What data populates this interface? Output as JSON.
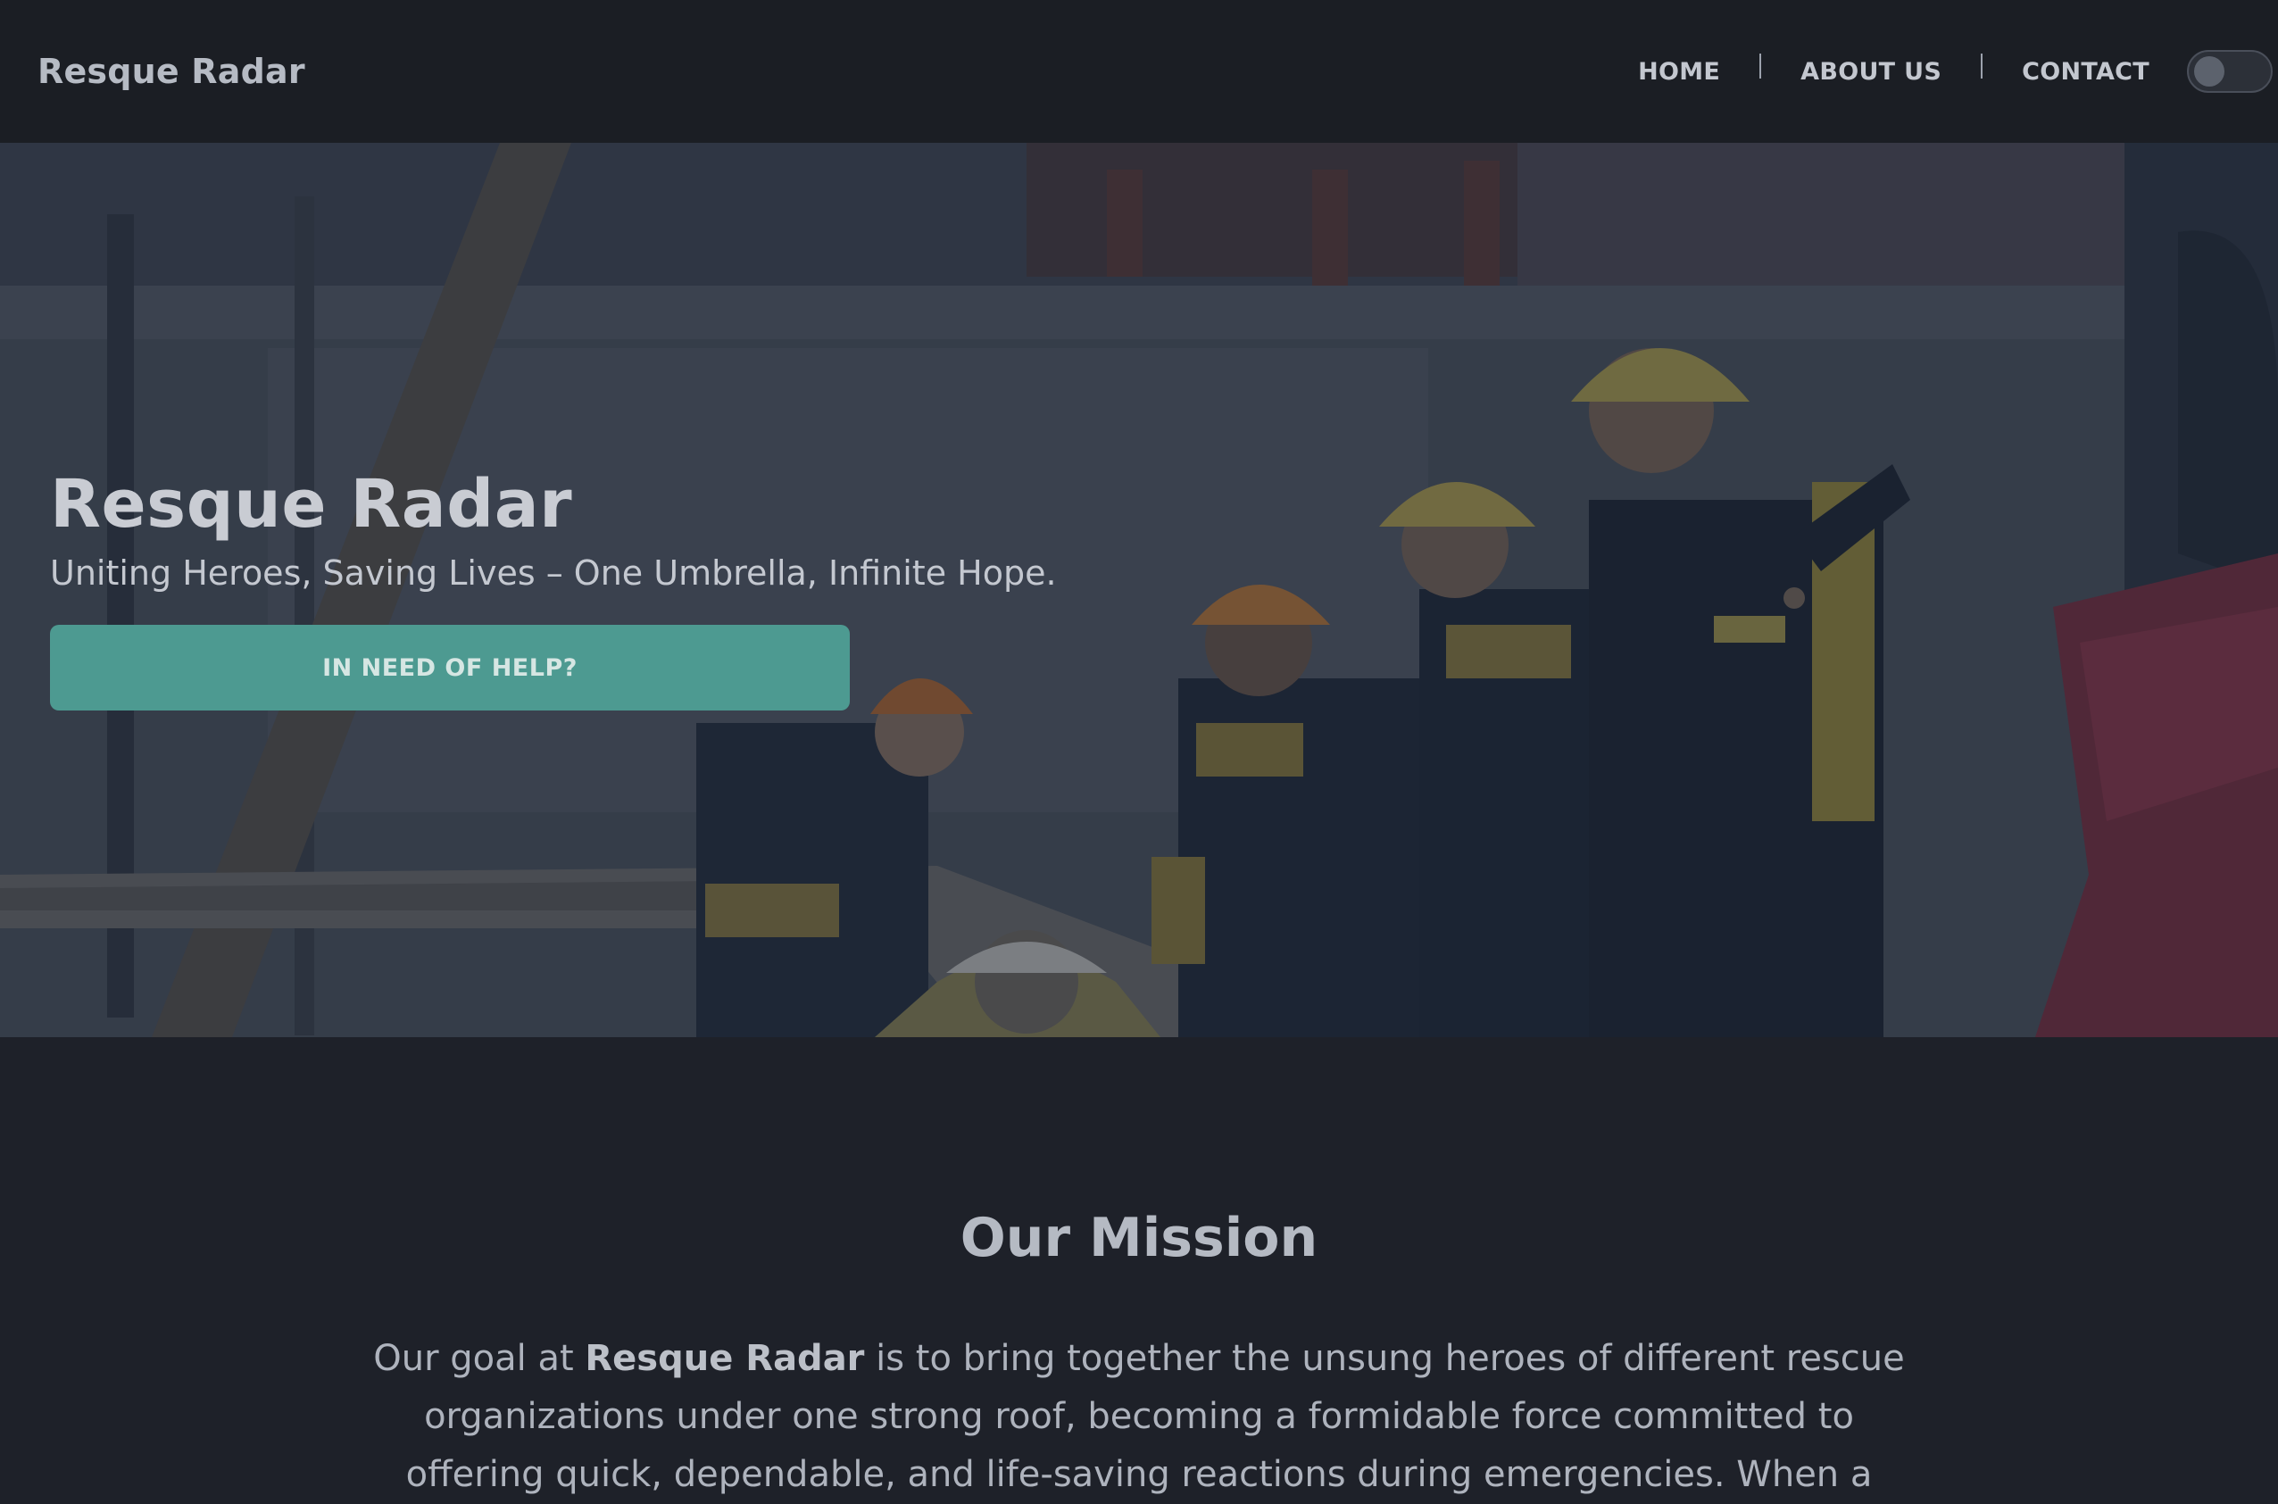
{
  "navbar": {
    "brand": "Resque Radar",
    "links": [
      "HOME",
      "ABOUT US",
      "CONTACT"
    ],
    "theme_toggle_state": "off"
  },
  "hero": {
    "background_image": "rescue-workers-photo",
    "title": "Resque Radar",
    "subtitle": "Uniting Heroes, Saving Lives – One Umbrella, Infinite Hope.",
    "cta_label": "IN NEED OF HELP?"
  },
  "mission": {
    "title": "Our Mission",
    "text_before": "Our goal at ",
    "text_bold": "Resque Radar",
    "text_after": " is to bring together the unsung heroes of different rescue organizations under one strong roof, becoming a formidable force committed to offering quick, dependable, and life-saving reactions during emergencies. When a"
  },
  "colors": {
    "navbar_bg": "#1b1e24",
    "page_bg": "#1e2129",
    "accent": "#4d9a91"
  }
}
